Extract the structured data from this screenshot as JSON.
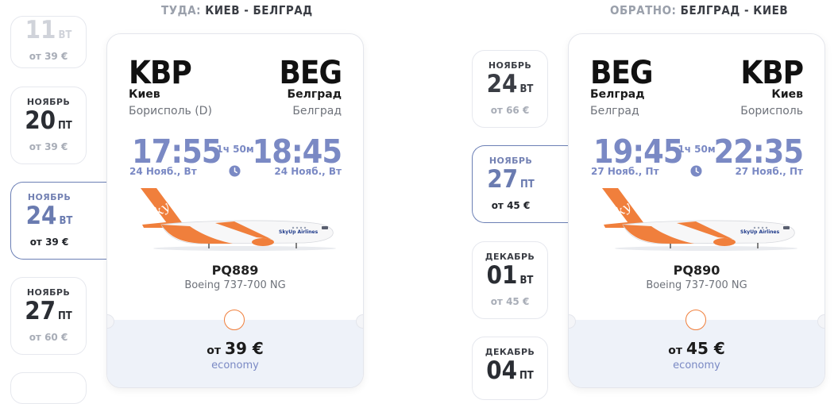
{
  "outbound": {
    "heading_prefix": "ТУДА:",
    "heading_route": "КИЕВ - БЕЛГРАД",
    "dates": [
      {
        "month": "",
        "day": "",
        "dow": "ВТ",
        "price": "от 39 €"
      },
      {
        "month": "НОЯБРЬ",
        "day": "20",
        "dow": "ПТ",
        "price": "от 39 €"
      },
      {
        "month": "НОЯБРЬ",
        "day": "24",
        "dow": "ВТ",
        "price": "от 39 €",
        "selected": true
      },
      {
        "month": "НОЯБРЬ",
        "day": "27",
        "dow": "ПТ",
        "price": "от 60 €"
      }
    ],
    "flight": {
      "from_code": "KBP",
      "from_city": "Киев",
      "from_airport": "Борисполь (D)",
      "to_code": "BEG",
      "to_city": "Белград",
      "to_airport": "Белград",
      "dep_time": "17:55",
      "dep_date": "24 Нояб., Вт",
      "arr_time": "18:45",
      "arr_date": "24 Нояб., Вт",
      "duration": "1ч 50м",
      "flight_number": "PQ889",
      "aircraft": "Boeing 737-700 NG",
      "price_prefix": "от",
      "price": "39 €",
      "fare_class": "economy"
    }
  },
  "return": {
    "heading_prefix": "ОБРАТНО:",
    "heading_route": "БЕЛГРАД - КИЕВ",
    "dates": [
      {
        "month": "НОЯБРЬ",
        "day": "24",
        "dow": "ВТ",
        "price": "от 66 €"
      },
      {
        "month": "НОЯБРЬ",
        "day": "27",
        "dow": "ПТ",
        "price": "от 45 €",
        "selected": true
      },
      {
        "month": "ДЕКАБРЬ",
        "day": "01",
        "dow": "ВТ",
        "price": "от 45 €"
      },
      {
        "month": "ДЕКАБРЬ",
        "day": "04",
        "dow": "ПТ",
        "price": ""
      }
    ],
    "flight": {
      "from_code": "BEG",
      "from_city": "Белград",
      "from_airport": "Белград",
      "to_code": "KBP",
      "to_city": "Киев",
      "to_airport": "Борисполь",
      "dep_time": "19:45",
      "dep_date": "27 Нояб., Пт",
      "arr_time": "22:35",
      "arr_date": "27 Нояб., Пт",
      "duration": "1ч 50м",
      "flight_number": "PQ890",
      "aircraft": "Boeing 737-700 NG",
      "price_prefix": "от",
      "price": "45 €",
      "fare_class": "economy"
    }
  },
  "airline_livery": {
    "brand_text": "SkyUp",
    "fuselage_text": "SkyUp Airlines"
  },
  "colors": {
    "accent_blue": "#7a89c4",
    "accent_orange": "#f07f3c"
  },
  "icons": {
    "duration": "clock-icon",
    "aircraft": "airplane-image"
  }
}
